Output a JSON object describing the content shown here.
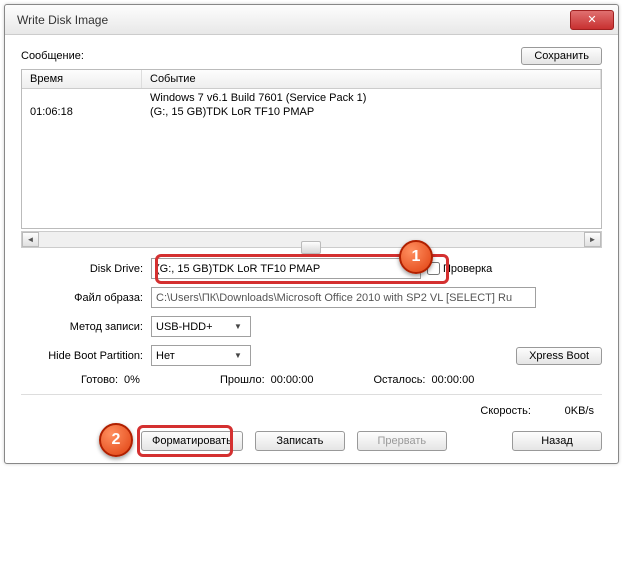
{
  "window": {
    "title": "Write Disk Image"
  },
  "header": {
    "message_label": "Сообщение:",
    "save_btn": "Сохранить"
  },
  "log": {
    "col_time": "Время",
    "col_event": "Событие",
    "rows": [
      {
        "time": "",
        "event": "Windows 7 v6.1 Build 7601 (Service Pack 1)"
      },
      {
        "time": "01:06:18",
        "event": "(G:, 15 GB)TDK LoR TF10            PMAP"
      }
    ]
  },
  "fields": {
    "disk_drive_label": "Disk Drive:",
    "disk_drive_value": "(G:, 15 GB)TDK LoR TF10            PMAP",
    "check_label": "Проверка",
    "image_file_label": "Файл образа:",
    "image_file_value": "C:\\Users\\ПК\\Downloads\\Microsoft Office 2010 with SP2 VL [SELECT] Ru",
    "write_method_label": "Метод записи:",
    "write_method_value": "USB-HDD+",
    "hide_boot_label": "Hide Boot Partition:",
    "hide_boot_value": "Нет",
    "xpress_boot_btn": "Xpress Boot"
  },
  "status": {
    "ready_label": "Готово:",
    "ready_value": "0%",
    "elapsed_label": "Прошло:",
    "elapsed_value": "00:00:00",
    "remain_label": "Осталось:",
    "remain_value": "00:00:00",
    "speed_label": "Скорость:",
    "speed_value": "0KB/s"
  },
  "buttons": {
    "format": "Форматировать",
    "write": "Записать",
    "abort": "Прервать",
    "back": "Назад"
  },
  "badges": {
    "one": "1",
    "two": "2"
  }
}
